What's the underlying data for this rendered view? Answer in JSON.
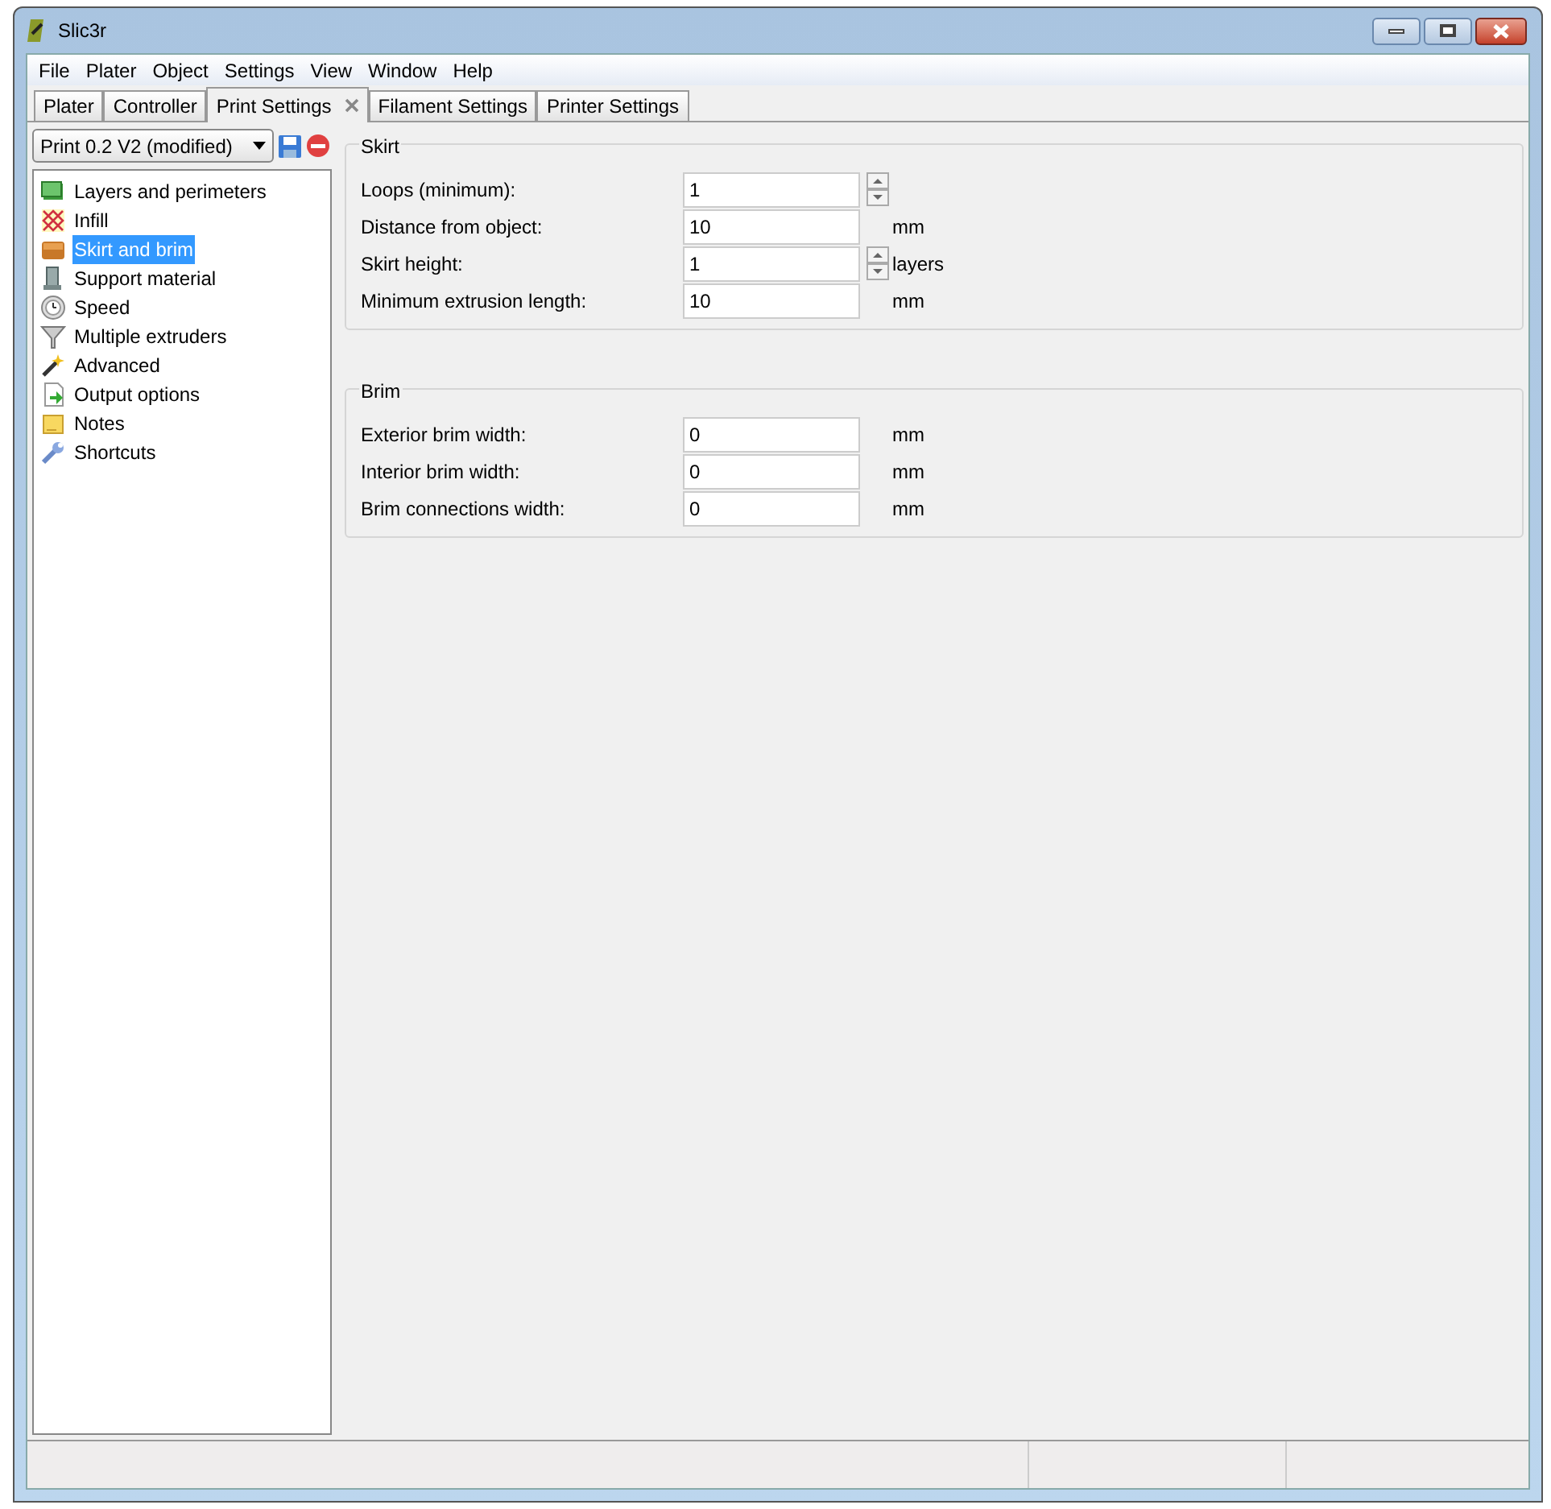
{
  "window": {
    "title": "Slic3r"
  },
  "menu": [
    "File",
    "Plater",
    "Object",
    "Settings",
    "View",
    "Window",
    "Help"
  ],
  "tabs": [
    {
      "label": "Plater",
      "selected": false,
      "closable": false
    },
    {
      "label": "Controller",
      "selected": false,
      "closable": false
    },
    {
      "label": "Print Settings",
      "selected": true,
      "closable": true
    },
    {
      "label": "Filament Settings",
      "selected": false,
      "closable": false
    },
    {
      "label": "Printer Settings",
      "selected": false,
      "closable": false
    }
  ],
  "preset": {
    "value": "Print 0.2 V2 (modified)"
  },
  "pages": [
    {
      "label": "Layers and perimeters",
      "selected": false
    },
    {
      "label": "Infill",
      "selected": false
    },
    {
      "label": "Skirt and brim",
      "selected": true
    },
    {
      "label": "Support material",
      "selected": false
    },
    {
      "label": "Speed",
      "selected": false
    },
    {
      "label": "Multiple extruders",
      "selected": false
    },
    {
      "label": "Advanced",
      "selected": false
    },
    {
      "label": "Output options",
      "selected": false
    },
    {
      "label": "Notes",
      "selected": false
    },
    {
      "label": "Shortcuts",
      "selected": false
    }
  ],
  "groups": [
    {
      "title": "Skirt",
      "fields": [
        {
          "label": "Loops (minimum):",
          "value": "1",
          "kind": "spin"
        },
        {
          "label": "Distance from object:",
          "value": "10",
          "kind": "text",
          "unit": "mm"
        },
        {
          "label": "Skirt height:",
          "value": "1",
          "kind": "spin",
          "unit": "layers"
        },
        {
          "label": "Minimum extrusion length:",
          "value": "10",
          "kind": "text",
          "unit": "mm"
        }
      ]
    },
    {
      "title": "Brim",
      "fields": [
        {
          "label": "Exterior brim width:",
          "value": "0",
          "kind": "text",
          "unit": "mm"
        },
        {
          "label": "Interior brim width:",
          "value": "0",
          "kind": "text",
          "unit": "mm"
        },
        {
          "label": "Brim connections width:",
          "value": "0",
          "kind": "text",
          "unit": "mm"
        }
      ]
    }
  ]
}
